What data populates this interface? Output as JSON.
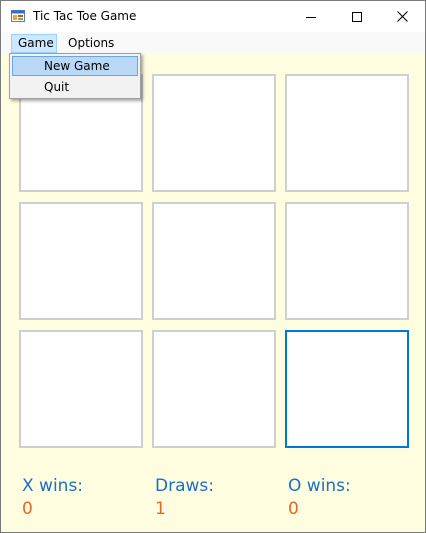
{
  "window": {
    "title": "Tic Tac Toe Game"
  },
  "menubar": {
    "items": [
      {
        "label": "Game"
      },
      {
        "label": "Options"
      }
    ]
  },
  "dropdown": {
    "items": [
      {
        "label": "New Game"
      },
      {
        "label": "Quit"
      }
    ]
  },
  "board": {
    "cells": [
      "",
      "",
      "",
      "",
      "",
      "",
      "",
      "",
      ""
    ],
    "focused_cell": 9
  },
  "stats": {
    "x_label": "X wins:",
    "x_value": "0",
    "draws_label": "Draws:",
    "draws_value": "1",
    "o_label": "O wins:",
    "o_value": "0"
  },
  "colors": {
    "client_background": "#fffde0",
    "label_color": "#1b6fc8",
    "value_color": "#e8652b",
    "focus_border": "#0078d7"
  }
}
